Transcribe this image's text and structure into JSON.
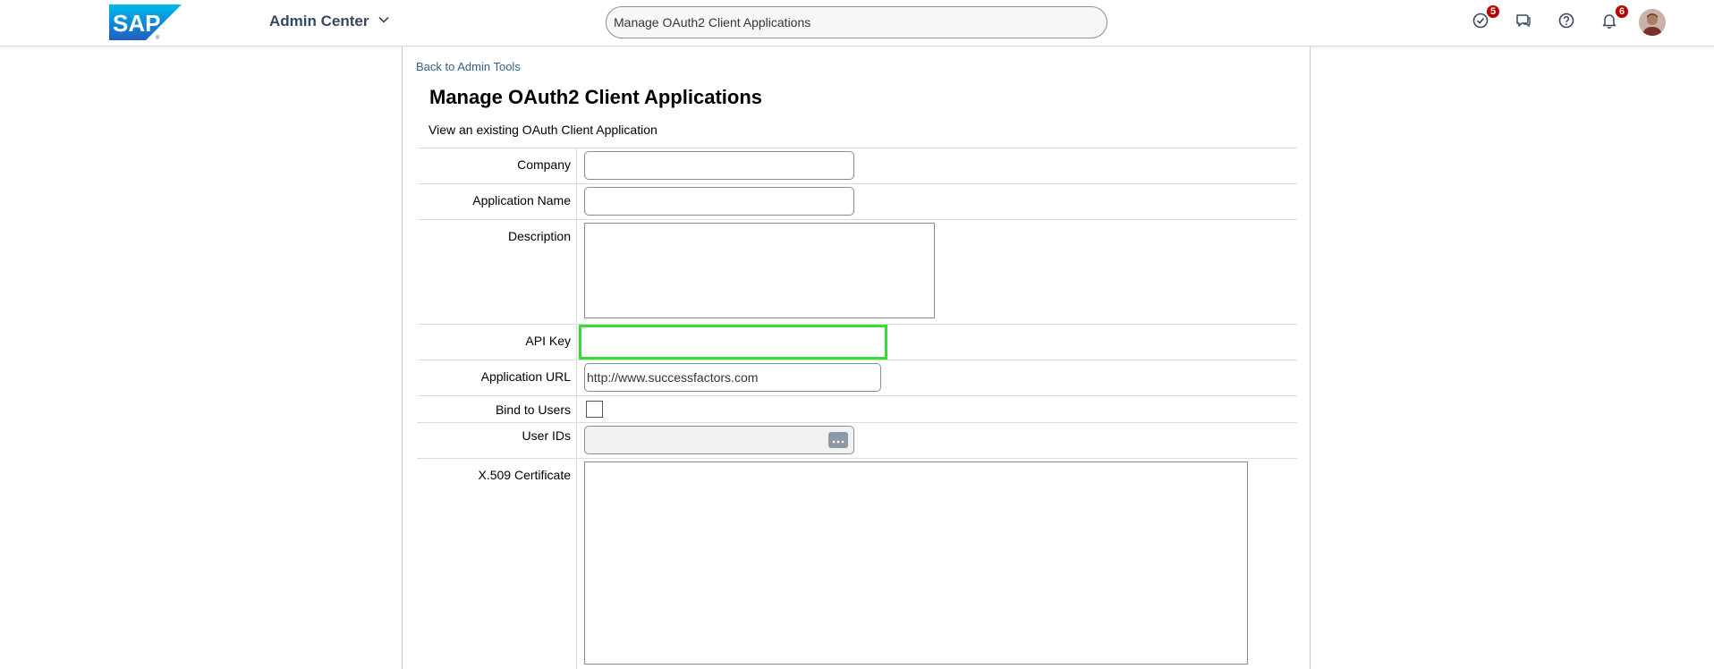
{
  "shell": {
    "logo_text": "SAP",
    "app_title": "Admin Center",
    "search_value": "Manage OAuth2 Client Applications",
    "todo_count": "5",
    "notification_count": "6"
  },
  "page": {
    "back_link": "Back to Admin Tools",
    "title": "Manage OAuth2 Client Applications",
    "subtitle": "View an existing OAuth Client Application"
  },
  "form": {
    "company_label": "Company",
    "company_value": "",
    "app_name_label": "Application Name",
    "app_name_value": "",
    "description_label": "Description",
    "description_value": "",
    "api_key_label": "API Key",
    "api_key_value": "",
    "app_url_label": "Application URL",
    "app_url_value": "http://www.successfactors.com",
    "bind_users_label": "Bind to Users",
    "bind_users_checked": false,
    "user_ids_label": "User IDs",
    "user_ids_value": "",
    "cert_label": "X.509 Certificate",
    "cert_value": ""
  },
  "colors": {
    "accent": "#0a6ed1",
    "focus_border": "#33dd33",
    "badge": "#bb0000"
  }
}
